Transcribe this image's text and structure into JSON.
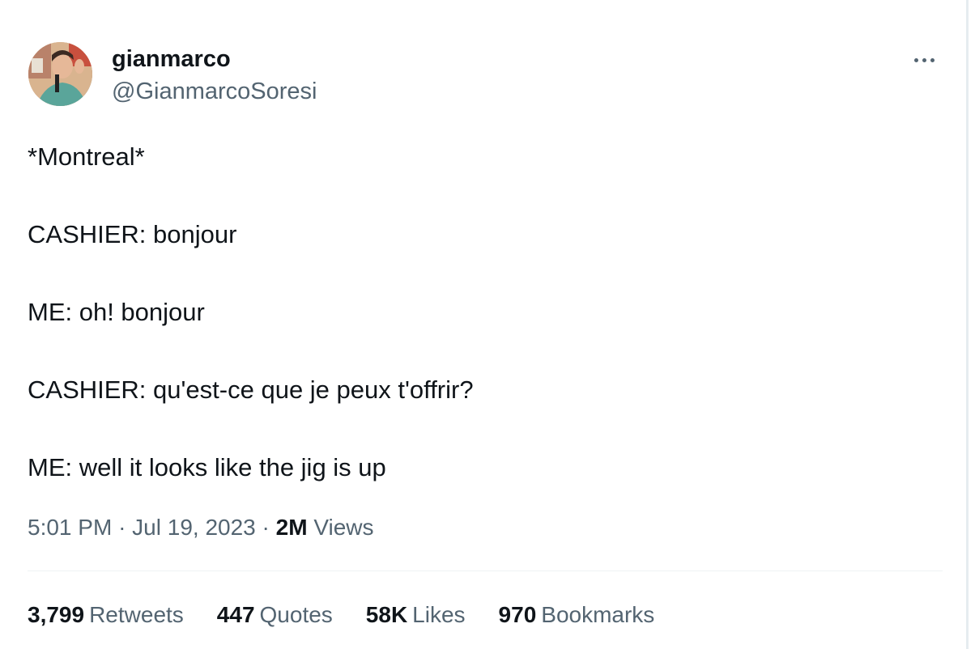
{
  "author": {
    "display_name": "gianmarco",
    "handle": "@GianmarcoSoresi"
  },
  "menu": {
    "icon": "more-horizontal-icon"
  },
  "tweet": {
    "lines": [
      "*Montreal*",
      "CASHIER: bonjour",
      "ME: oh! bonjour",
      "CASHIER: qu'est-ce que je peux t'offrir?",
      "ME: well it looks like the jig is up"
    ]
  },
  "meta": {
    "time": "5:01 PM",
    "separator": "·",
    "date": "Jul 19, 2023",
    "views_count": "2M",
    "views_label": "Views"
  },
  "stats": {
    "retweets": {
      "count": "3,799",
      "label": "Retweets"
    },
    "quotes": {
      "count": "447",
      "label": "Quotes"
    },
    "likes": {
      "count": "58K",
      "label": "Likes"
    },
    "bookmarks": {
      "count": "970",
      "label": "Bookmarks"
    }
  },
  "colors": {
    "text_primary": "#0f1419",
    "text_secondary": "#536471",
    "divider": "#eff3f4"
  }
}
